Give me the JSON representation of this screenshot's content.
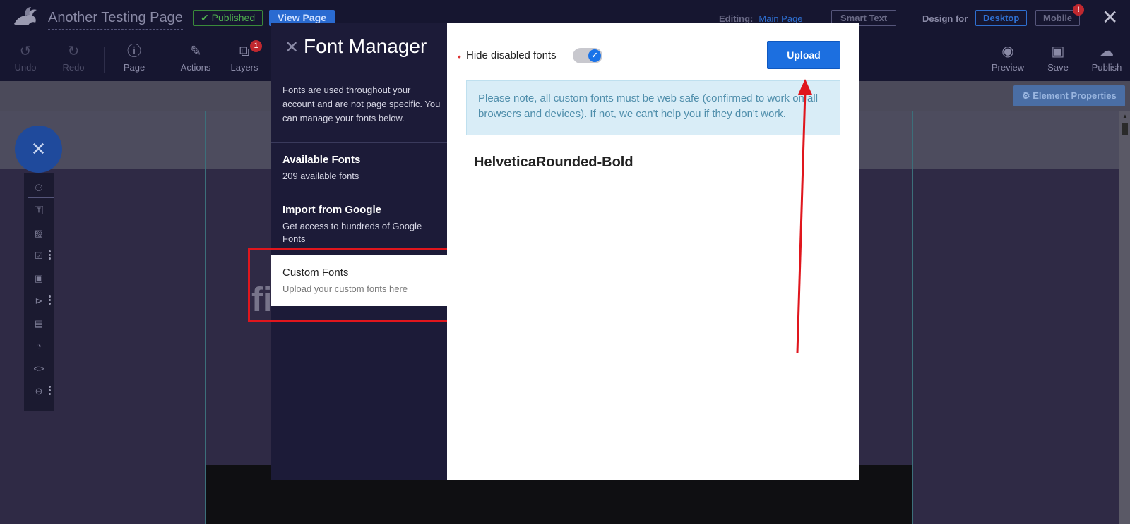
{
  "header": {
    "page_title": "Another Testing Page",
    "published_label": "✔ Published",
    "view_page_label": "View Page",
    "editing_label": "Editing:",
    "editing_target": "Main Page",
    "smart_text_label": "Smart Text",
    "design_for_label": "Design for",
    "desktop_label": "Desktop",
    "mobile_label": "Mobile",
    "mobile_alert": "!"
  },
  "toolbar": {
    "undo": "Undo",
    "redo": "Redo",
    "page": "Page",
    "actions": "Actions",
    "layers": "Layers",
    "layers_count": "1",
    "preview": "Preview",
    "save": "Save",
    "publish": "Publish"
  },
  "subbar": {
    "element_properties": "⚙ Element Properties"
  },
  "canvas": {
    "partial_text": "fi"
  },
  "modal": {
    "title": "Font Manager",
    "description": "Fonts are used throughout your account and are not page specific. You can manage your fonts below.",
    "menu": [
      {
        "title": "Available Fonts",
        "subtitle": "209 available fonts"
      },
      {
        "title": "Import from Google",
        "subtitle": "Get access to hundreds of Google Fonts"
      },
      {
        "title": "Custom Fonts",
        "subtitle": "Upload your custom fonts here"
      }
    ],
    "hide_disabled_label": "Hide disabled fonts",
    "hide_disabled_enabled": true,
    "upload_label": "Upload",
    "notice": "Please note, all custom fonts must be web safe (confirmed to work on all browsers and devices). If not, we can't help you if they don't work.",
    "fonts": [
      "HelveticaRounded-Bold"
    ]
  },
  "colors": {
    "accent": "#1c6fe0",
    "annotation": "#e0161d",
    "modal_dark": "#1c1b38"
  }
}
